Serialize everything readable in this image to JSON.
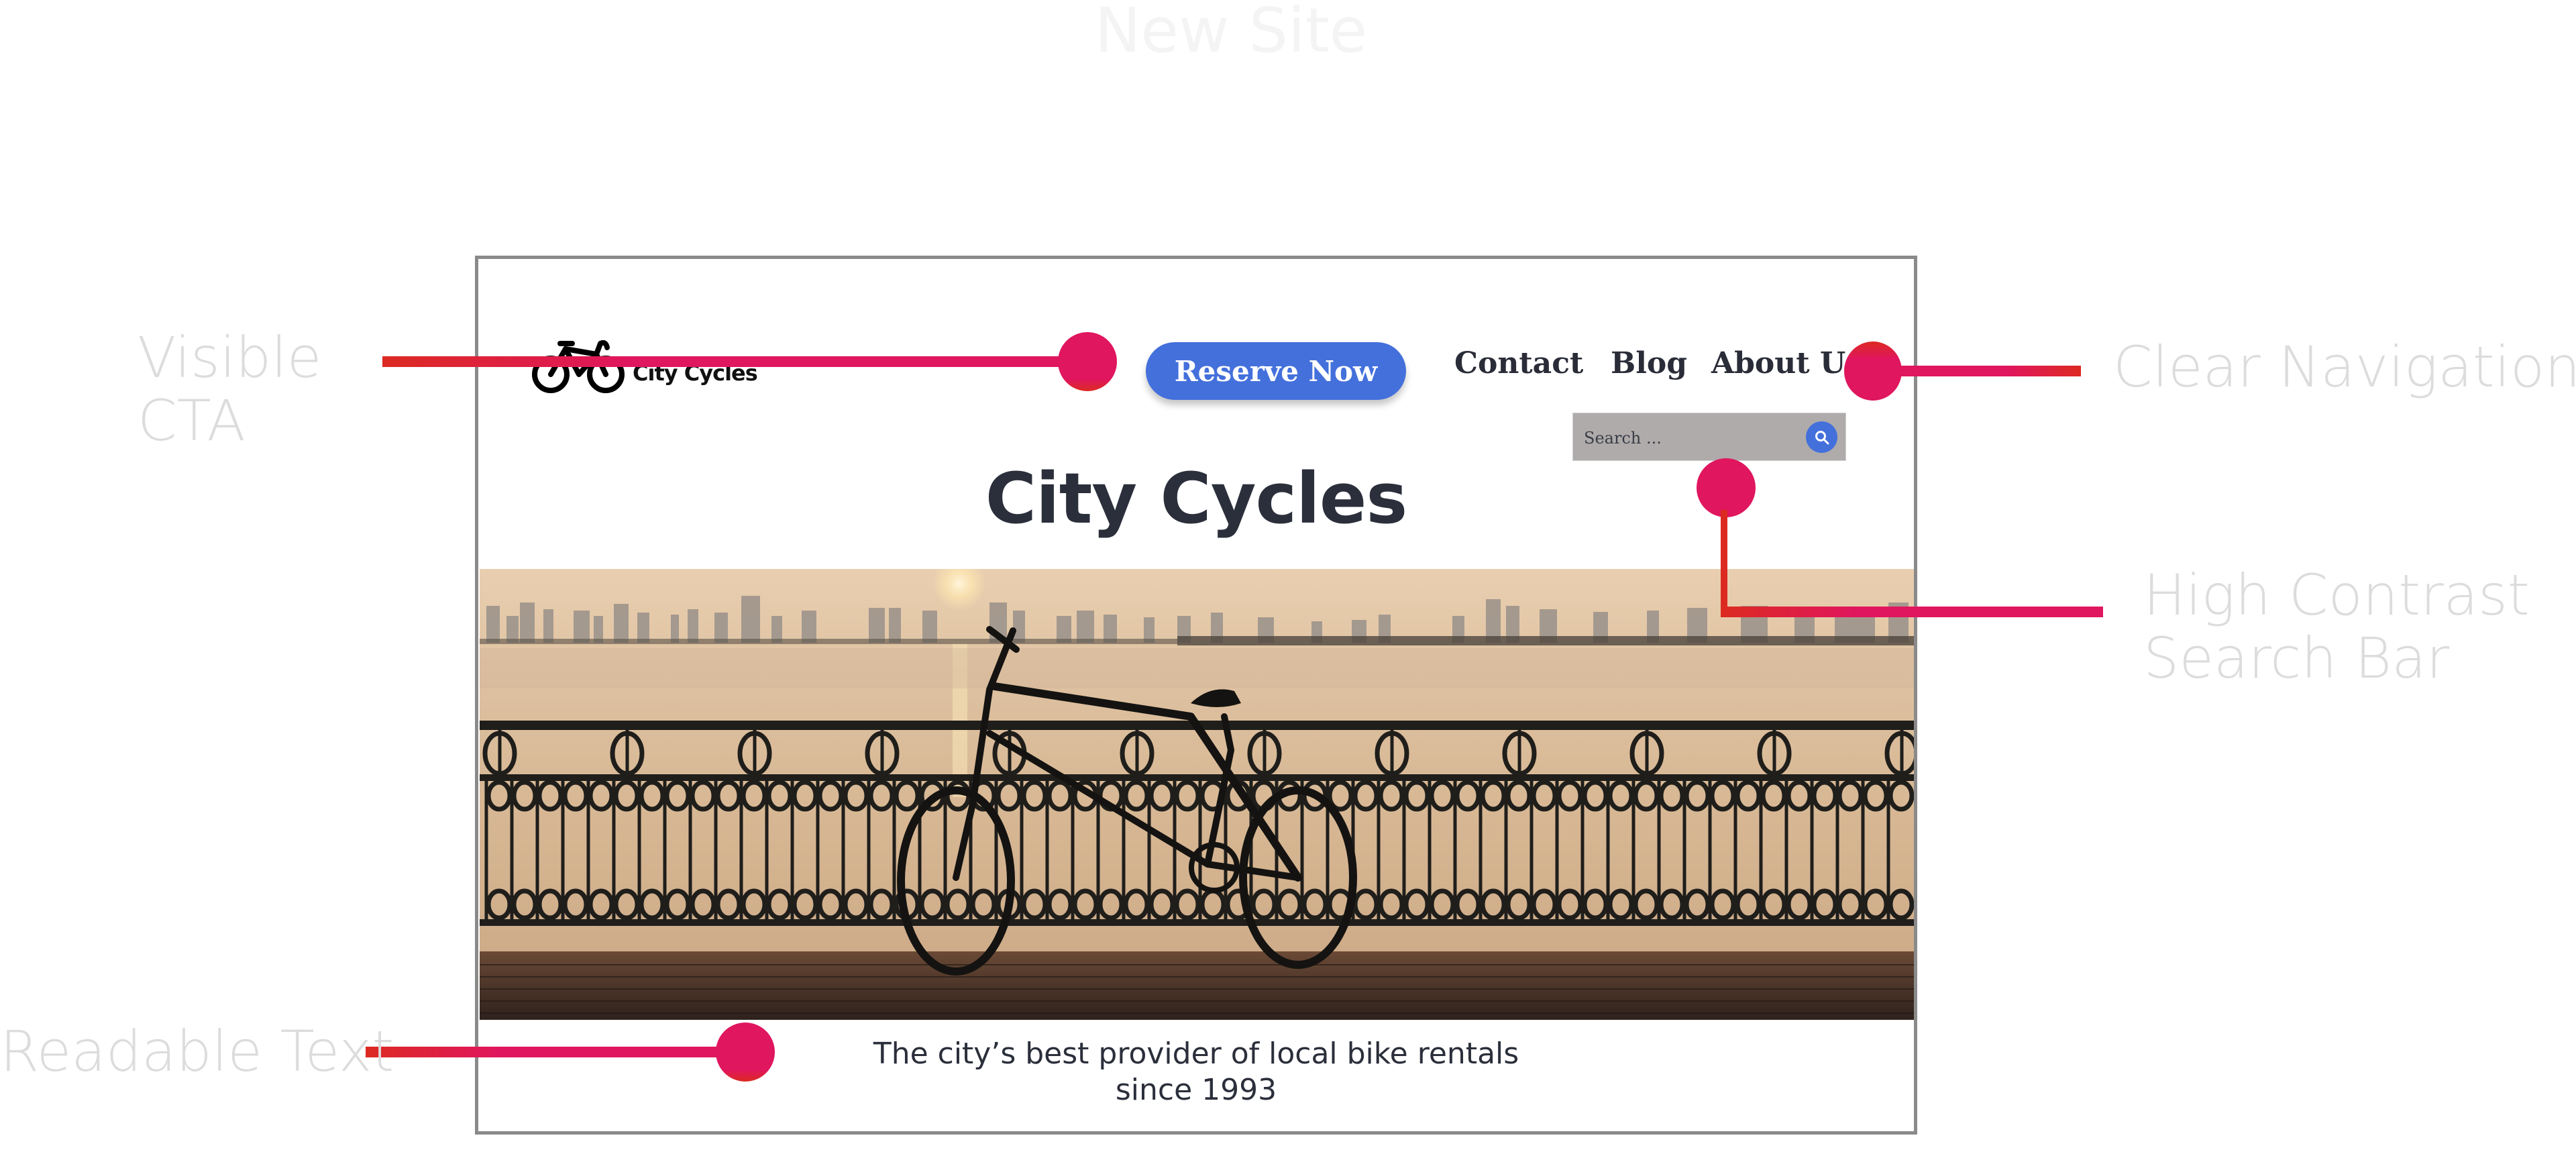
{
  "page_title": "New Site",
  "colors": {
    "accent_blue": "#4470dc",
    "callout_pink": "#e0165e",
    "callout_red": "#dc2a22",
    "heading_text": "#2b2f3b",
    "annotation_text": "#dcdcdc",
    "frame_border": "#8a8a8a",
    "search_bg": "#aeabaa"
  },
  "mockup": {
    "logo": {
      "icon": "bicycle-icon",
      "text": "City Cycles"
    },
    "cta_label": "Reserve Now",
    "nav": [
      {
        "label": "Contact"
      },
      {
        "label": "Blog"
      },
      {
        "label": "About Us"
      }
    ],
    "search": {
      "placeholder": "Search ...",
      "icon": "search-icon"
    },
    "heading": "City Cycles",
    "hero_image": {
      "description": "Silhouette of a bicycle leaning against an ornate railing by a lake at sunset with a city skyline"
    },
    "tagline_line1": "The city’s best provider of local bike rentals",
    "tagline_line2": "since 1993"
  },
  "annotations": [
    {
      "id": "cta",
      "line1": "Visible",
      "line2": "CTA"
    },
    {
      "id": "nav",
      "line1": "Clear Navigation"
    },
    {
      "id": "search",
      "line1": "High Contrast",
      "line2": "Search Bar"
    },
    {
      "id": "text",
      "line1": "Readable Text"
    }
  ]
}
